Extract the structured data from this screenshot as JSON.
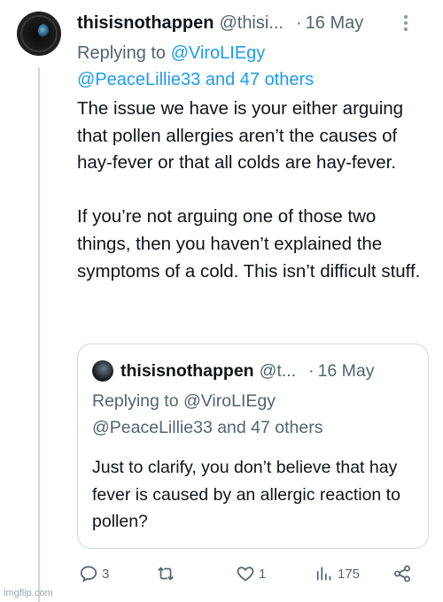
{
  "tweet": {
    "display_name": "thisisnothappen",
    "handle": "@thisi...",
    "separator": "·",
    "date": "16 May",
    "replying_prefix": "Replying to",
    "replying_to_1": "@ViroLIEgy",
    "replying_to_2": "@PeaceLillie33 and 47 others",
    "body_p1": "The issue we have is your either arguing that pollen allergies aren’t the causes of hay-fever or that all colds are hay-fever.",
    "body_p2": "If you’re not arguing one of those two things, then you haven’t explained the symptoms of a cold. This isn’t difficult stuff."
  },
  "quote": {
    "display_name": "thisisnothappen",
    "handle": "@t...",
    "separator": "·",
    "date": "16 May",
    "replying_line1": "Replying to @ViroLIEgy",
    "replying_line2": "@PeaceLillie33 and 47 others",
    "body": "Just to clarify, you don’t believe that hay fever is caused by an allergic reaction to pollen?"
  },
  "actions": {
    "reply_count": "3",
    "retweet_count": "",
    "like_count": "1",
    "views_count": "175"
  },
  "icons": {
    "reply": "speech-bubble-icon",
    "retweet": "retweet-icon",
    "like": "heart-icon",
    "views": "bar-chart-icon",
    "share": "share-icon",
    "more": "more-vertical-icon"
  },
  "watermark": "imgflip.com",
  "colors": {
    "link": "#1d9bf0",
    "secondary_text": "#536471",
    "border": "#cfd9de"
  }
}
